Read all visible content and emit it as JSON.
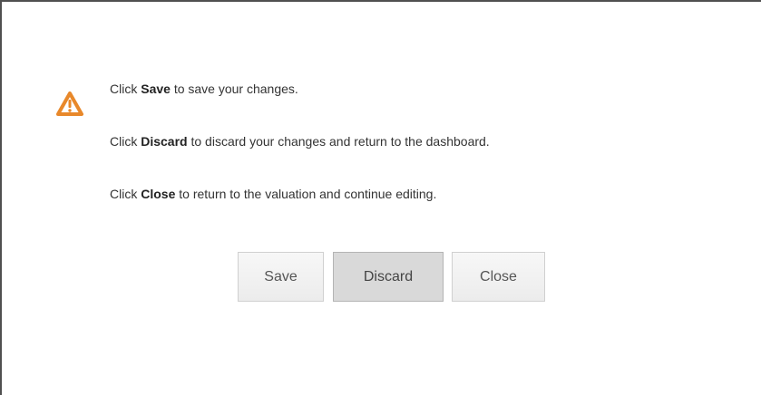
{
  "dialog": {
    "icon": "warning-triangle-icon",
    "icon_color": "#e8882a",
    "messages": [
      {
        "prefix": "Click ",
        "action": "Save",
        "suffix": " to save your changes."
      },
      {
        "prefix": "Click ",
        "action": "Discard",
        "suffix": " to discard your changes and return to the dashboard."
      },
      {
        "prefix": "Click ",
        "action": "Close",
        "suffix": " to return to the valuation and continue editing."
      }
    ],
    "buttons": {
      "save_label": "Save",
      "discard_label": "Discard",
      "close_label": "Close"
    }
  }
}
